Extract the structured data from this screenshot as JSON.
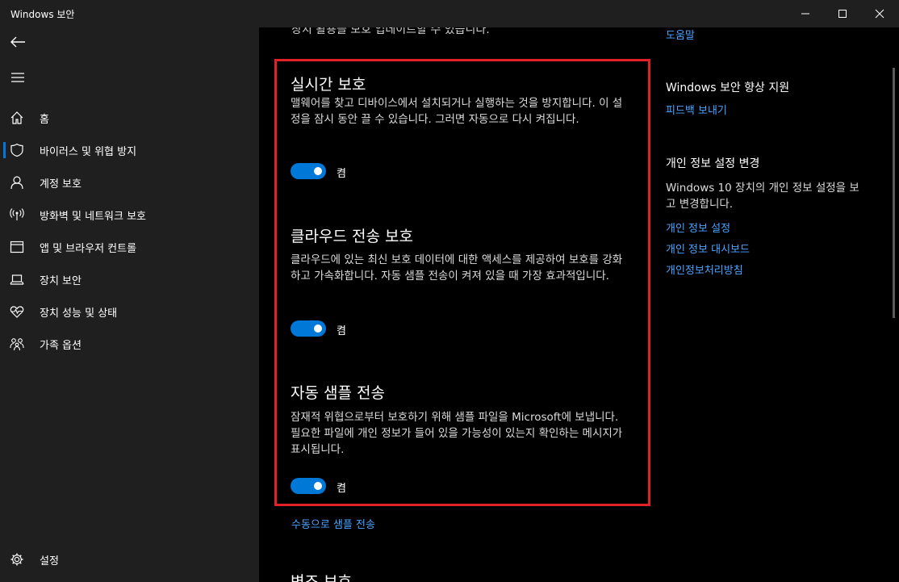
{
  "window": {
    "title": "Windows 보안"
  },
  "sidebar": {
    "items": [
      {
        "label": "홈",
        "icon": "home-icon"
      },
      {
        "label": "바이러스 및 위협 방지",
        "icon": "shield-icon",
        "selected": true
      },
      {
        "label": "계정 보호",
        "icon": "person-icon"
      },
      {
        "label": "방화벽 및 네트워크 보호",
        "icon": "antenna-icon"
      },
      {
        "label": "앱 및 브라우저 컨트롤",
        "icon": "app-window-icon"
      },
      {
        "label": "장치 보안",
        "icon": "laptop-icon"
      },
      {
        "label": "장치 성능 및 상태",
        "icon": "heart-pulse-icon"
      },
      {
        "label": "가족 옵션",
        "icon": "family-icon"
      }
    ],
    "settings_label": "설정"
  },
  "main": {
    "top_cut_text": "장치 활용을 보호 업데이트할 수 있습니다.",
    "sections": [
      {
        "title": "실시간 보호",
        "desc": "맬웨어를 찾고 디바이스에서 설치되거나 실행하는 것을 방지합니다. 이 설정을 잠시 동안 끌 수 있습니다. 그러면 자동으로 다시 켜집니다.",
        "toggle_label": "켬",
        "toggle_on": true
      },
      {
        "title": "클라우드 전송 보호",
        "desc": "클라우드에 있는 최신 보호 데이터에 대한 액세스를 제공하여 보호를 강화하고 가속화합니다. 자동 샘플 전송이 켜져 있을 때 가장 효과적입니다.",
        "toggle_label": "켬",
        "toggle_on": true
      },
      {
        "title": "자동 샘플 전송",
        "desc": "잠재적 위협으로부터 보호하기 위해 샘플 파일을 Microsoft에 보냅니다. 필요한 파일에 개인 정보가 들어 있을 가능성이 있는지 확인하는 메시지가 표시됩니다.",
        "toggle_label": "켬",
        "toggle_on": true
      }
    ],
    "manual_sample_link": "수동으로 샘플 전송",
    "bottom_cut_title": "변조 보호",
    "highlight_color": "#e02127",
    "accent_color": "#0078d7"
  },
  "right_panel": {
    "help_link": "도움말",
    "improve_heading": "Windows 보안 향상 지원",
    "feedback_link": "피드백 보내기",
    "privacy_heading": "개인 정보 설정 변경",
    "privacy_desc": "Windows 10 장치의 개인 정보 설정을 보고 변경합니다.",
    "links": [
      "개인 정보 설정",
      "개인 정보 대시보드",
      "개인정보처리방침"
    ]
  }
}
